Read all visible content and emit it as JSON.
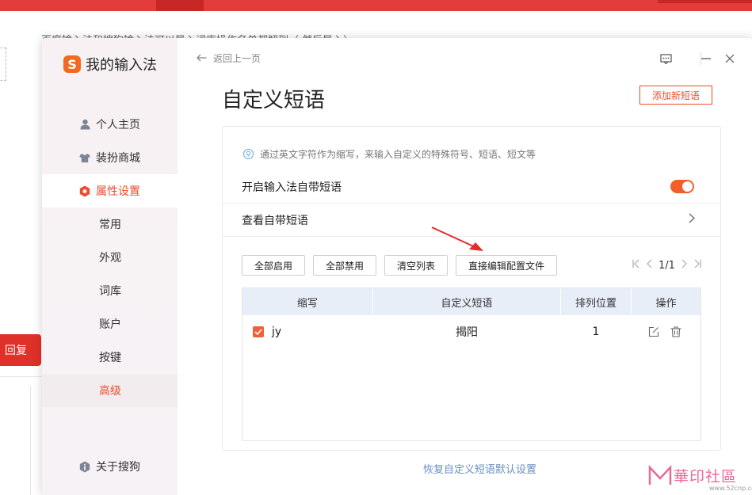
{
  "background": {
    "top_text": "百度输入法和搜狗输入法可以导入词库操作名单都解到（ 然后导入）",
    "reply_label": "回复"
  },
  "app": {
    "name": "我的输入法",
    "logo_letter": "S",
    "brand_color": "#f26a22",
    "accent_color": "#ee4d2d"
  },
  "sidebar": {
    "items": [
      {
        "label": "个人主页",
        "icon": "user-icon"
      },
      {
        "label": "装扮商城",
        "icon": "shirt-icon"
      },
      {
        "label": "属性设置",
        "icon": "settings-hex-icon",
        "active": true
      }
    ],
    "subitems": [
      {
        "label": "常用"
      },
      {
        "label": "外观"
      },
      {
        "label": "词库"
      },
      {
        "label": "账户"
      },
      {
        "label": "按键"
      },
      {
        "label": "高级",
        "active": true
      }
    ],
    "about": {
      "label": "关于搜狗",
      "icon": "info-icon"
    }
  },
  "header": {
    "back_label": "返回上一页",
    "title": "自定义短语",
    "add_button": "添加新短语"
  },
  "card": {
    "tip": "通过英文字符作为缩写，来输入自定义的特殊符号、短语、短文等",
    "toggle_row": {
      "label": "开启输入法自带短语",
      "enabled": true
    },
    "view_row": {
      "label": "查看自带短语"
    },
    "buttons": {
      "enable_all": "全部启用",
      "disable_all": "全部禁用",
      "clear_list": "清空列表",
      "edit_config": "直接编辑配置文件"
    },
    "pager": {
      "page": "1/1"
    },
    "table": {
      "headers": [
        "缩写",
        "自定义短语",
        "排列位置",
        "操作"
      ],
      "rows": [
        {
          "abbr": "jy",
          "phrase": "揭阳",
          "position": "1",
          "checked": true
        }
      ]
    }
  },
  "footer": {
    "restore_link": "恢复自定义短语默认设置"
  },
  "watermark": {
    "text": "華印社區",
    "url": "www.52cnp.com"
  }
}
